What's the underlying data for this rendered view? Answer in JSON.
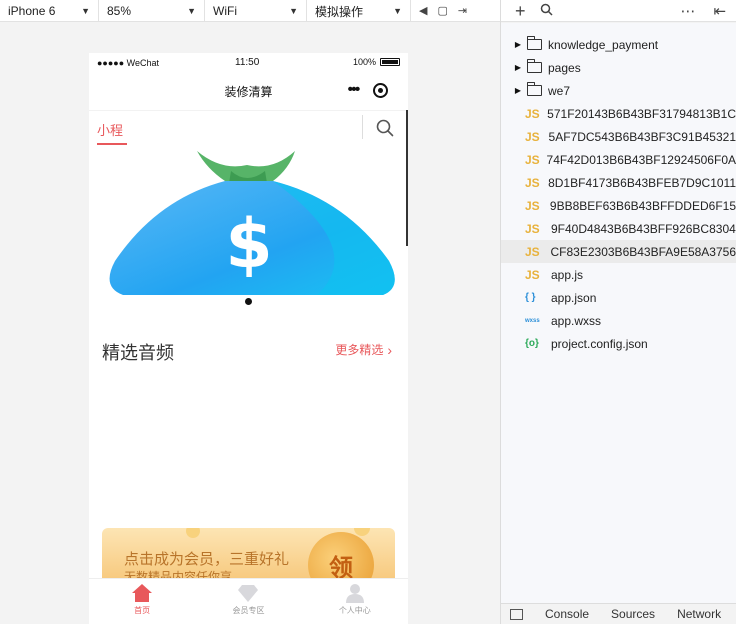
{
  "toolbar": {
    "device": "iPhone 6",
    "zoom": "85%",
    "network": "WiFi",
    "operation": "模拟操作",
    "icons": [
      "volume-icon",
      "window-icon",
      "rotate-icon"
    ],
    "right_icons": [
      "plus-icon",
      "search-icon",
      "more-icon",
      "collapse-icon"
    ]
  },
  "phone": {
    "status": {
      "carrier": "●●●●● WeChat",
      "time": "11:50",
      "battery": "100%"
    },
    "nav_title": "装修清算",
    "capsule_dots": "•••",
    "tab_label": "小程",
    "section_title": "精选音频",
    "section_more": "更多精选",
    "member_card": {
      "title": "点击成为会员，三重好礼",
      "subtitle": "无数精品内容任你享",
      "coin_text": "领"
    },
    "tabbar": [
      {
        "label": "首页",
        "active": true
      },
      {
        "label": "会员专区",
        "active": false
      },
      {
        "label": "个人中心",
        "active": false
      }
    ],
    "accent": "#e8585b"
  },
  "file_tree": {
    "folders": [
      "knowledge_payment",
      "pages",
      "we7"
    ],
    "files": [
      {
        "type": "JS",
        "name": "571F20143B6B43BF31794813B1C"
      },
      {
        "type": "JS",
        "name": "5AF7DC543B6B43BF3C91B45321"
      },
      {
        "type": "JS",
        "name": "74F42D013B6B43BF12924506F0A"
      },
      {
        "type": "JS",
        "name": "8D1BF4173B6B43BFEB7D9C1011"
      },
      {
        "type": "JS",
        "name": "9BB8BEF63B6B43BFFDDED6F15"
      },
      {
        "type": "JS",
        "name": "9F40D4843B6B43BFF926BC8304"
      },
      {
        "type": "JS",
        "name": "CF83E2303B6B43BFA9E58A3756",
        "selected": true
      },
      {
        "type": "JS",
        "name": "app.js"
      },
      {
        "type": "{ }",
        "name": "app.json"
      },
      {
        "type": "wxss",
        "name": "app.wxss"
      },
      {
        "type": "{o}",
        "name": "project.config.json"
      }
    ]
  },
  "devtools_tabs": [
    "Console",
    "Sources",
    "Network"
  ]
}
